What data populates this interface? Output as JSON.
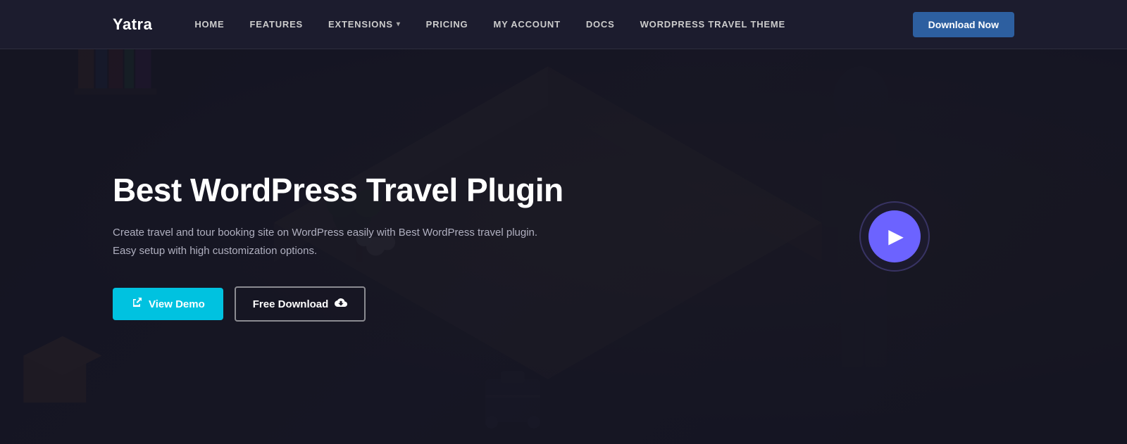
{
  "site": {
    "logo": "Yatra"
  },
  "nav": {
    "items": [
      {
        "label": "HOME",
        "hasArrow": false
      },
      {
        "label": "FEATURES",
        "hasArrow": false
      },
      {
        "label": "EXTENSIONS",
        "hasArrow": true
      },
      {
        "label": "PRICING",
        "hasArrow": false
      },
      {
        "label": "MY ACCOUNT",
        "hasArrow": false
      },
      {
        "label": "DOCS",
        "hasArrow": false
      },
      {
        "label": "WORDPRESS TRAVEL THEME",
        "hasArrow": false
      }
    ],
    "download_button": "Download Now"
  },
  "hero": {
    "title": "Best WordPress Travel Plugin",
    "subtitle": "Create travel and tour booking site on WordPress easily with Best WordPress travel plugin. Easy setup with high customization options.",
    "btn_view_demo": "View Demo",
    "btn_free_download": "Free Download"
  },
  "colors": {
    "accent_cyan": "#00c2e0",
    "accent_purple": "#6c63ff",
    "nav_bg": "#1c1c2e",
    "download_btn_bg": "#2d5fa0"
  }
}
